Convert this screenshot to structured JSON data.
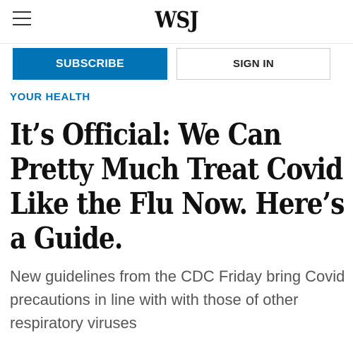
{
  "header": {
    "logo": "WSJ",
    "menu_icon": "hamburger-menu-icon"
  },
  "auth": {
    "subscribe_label": "SUBSCRIBE",
    "signin_label": "SIGN IN"
  },
  "article": {
    "section": "YOUR HEALTH",
    "headline": "It’s Official: We Can Pretty Much Treat Covid Like the Flu Now. Here’s a Guide.",
    "dek": "New guidelines from the CDC Friday bring Covid precautions in line with with those of other respiratory viruses"
  },
  "colors": {
    "accent": "#0274b6",
    "text": "#111111",
    "dek_text": "#555555"
  }
}
